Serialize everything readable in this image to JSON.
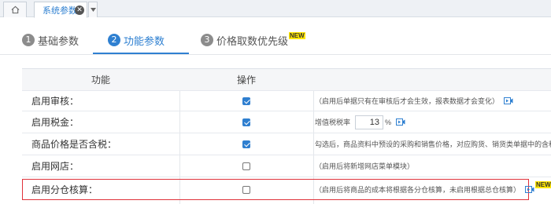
{
  "topbar": {
    "home_icon": "home-icon",
    "tab_label": "系统参数",
    "close_icon": "close-icon",
    "dropdown_icon": "caret-down-icon"
  },
  "steps": [
    {
      "num": "1",
      "label": "基础参数",
      "active": false
    },
    {
      "num": "2",
      "label": "功能参数",
      "active": true
    },
    {
      "num": "3",
      "label": "价格取数优先级",
      "active": false,
      "badge": "NEW"
    }
  ],
  "table": {
    "headers": {
      "function": "功能",
      "operation": "操作"
    },
    "rows": [
      {
        "label": "启用审核：",
        "checked": true,
        "desc": "（启用后单据只有在审核后才会生效，报表数据才会变化）",
        "video": true
      },
      {
        "label": "启用税金：",
        "checked": true,
        "desc_prefix": "增值税税率",
        "tax_value": "13",
        "tax_unit": "%",
        "video": true
      },
      {
        "label": "商品价格是否含税：",
        "checked": true,
        "desc": "勾选后，商品资料中预设的采购和销售价格，对应购货、销货类单据中的含税单价"
      },
      {
        "label": "启用网店：",
        "checked": false,
        "desc": "（启用后将新增网店菜单模块）"
      },
      {
        "label": "启用分仓核算：",
        "checked": false,
        "desc": "（启用后将商品的成本将根据各分仓核算，未启用根据总仓核算）",
        "video": true,
        "badge": "NEW",
        "highlighted": true
      }
    ]
  },
  "colors": {
    "accent": "#2f80d1",
    "highlight_border": "#e0323a",
    "badge_bg": "#ffe600"
  }
}
